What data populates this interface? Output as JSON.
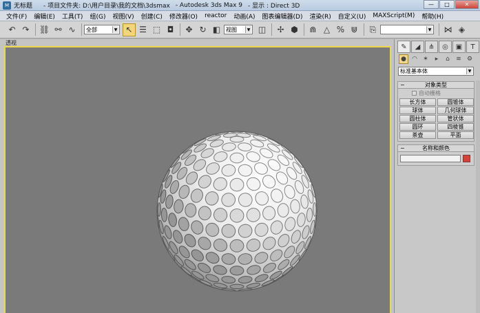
{
  "window": {
    "title_doc": "无标题",
    "title_path": "- 项目文件夹: D:\\用户目录\\我的文档\\3dsmax",
    "title_app": "- Autodesk 3ds Max 9",
    "title_display": "- 显示 : Direct 3D",
    "minimize": "—",
    "maximize": "□",
    "close": "✕"
  },
  "menu": [
    "文件(F)",
    "编辑(E)",
    "工具(T)",
    "组(G)",
    "视图(V)",
    "创建(C)",
    "修改器(O)",
    "reactor",
    "动画(A)",
    "图表编辑器(D)",
    "渲染(R)",
    "自定义(U)",
    "MAXScript(M)",
    "帮助(H)"
  ],
  "toolbar": {
    "selection_filter": "全部",
    "coord_system": "视图",
    "named_selection": ""
  },
  "viewport": {
    "label": "透视"
  },
  "command_panel": {
    "category": "标准基本体",
    "object_type_title": "对象类型",
    "autogrid": "自动栅格",
    "buttons": [
      "长方体",
      "圆锥体",
      "球体",
      "几何球体",
      "圆柱体",
      "管状体",
      "圆环",
      "四棱锥",
      "茶壶",
      "平面"
    ],
    "name_color_title": "名称和颜色",
    "object_name": "",
    "object_color": "#d9413b"
  }
}
